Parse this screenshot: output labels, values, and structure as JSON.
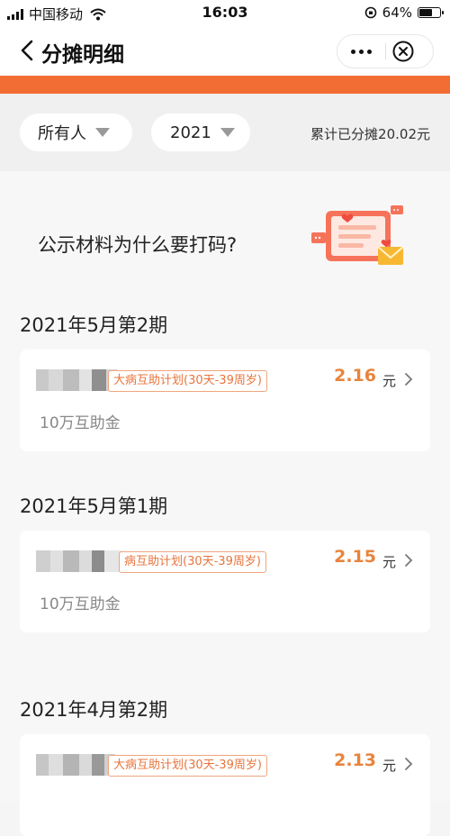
{
  "status_bar": {
    "carrier": "中国移动",
    "time": "16:03",
    "battery": "64%"
  },
  "nav": {
    "title": "分摊明细"
  },
  "filters": {
    "owner": "所有人",
    "year": "2021",
    "total_label": "累计已分摊20.02元"
  },
  "banner": {
    "title": "公示材料为什么要打码?"
  },
  "periods": [
    {
      "label": "2021年5月第2期",
      "plan": "大病互助计划(30天-39周岁)",
      "amount": "2.16",
      "unit": "元",
      "fund": "10万互助金"
    },
    {
      "label": "2021年5月第1期",
      "plan": "病互助计划(30天-39周岁)",
      "amount": "2.15",
      "unit": "元",
      "fund": "10万互助金"
    },
    {
      "label": "2021年4月第2期",
      "plan": "大病互助计划(30天-39周岁)",
      "amount": "2.13",
      "unit": "元",
      "fund": ""
    }
  ],
  "colors": {
    "accent": "#f26d34",
    "amount": "#e8843d",
    "tag_border": "#f0a57e"
  }
}
